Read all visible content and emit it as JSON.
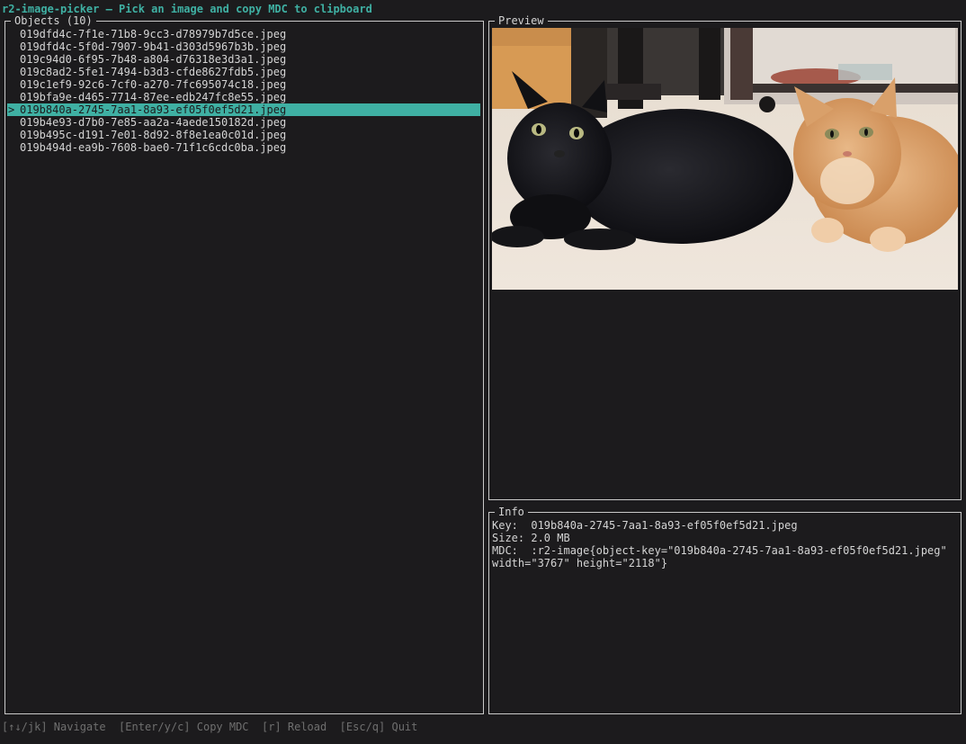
{
  "title": "r2-image-picker — Pick an image and copy MDC to clipboard",
  "objects": {
    "title": "Objects (10)",
    "selected_index": 6,
    "caret": ">",
    "items": [
      "019dfd4c-7f1e-71b8-9cc3-d78979b7d5ce.jpeg",
      "019dfd4c-5f0d-7907-9b41-d303d5967b3b.jpeg",
      "019c94d0-6f95-7b48-a804-d76318e3d3a1.jpeg",
      "019c8ad2-5fe1-7494-b3d3-cfde8627fdb5.jpeg",
      "019c1ef9-92c6-7cf0-a270-7fc695074c18.jpeg",
      "019bfa9e-d465-7714-87ee-edb247fc8e55.jpeg",
      "019b840a-2745-7aa1-8a93-ef05f0ef5d21.jpeg",
      "019b4e93-d7b0-7e85-aa2a-4aede150182d.jpeg",
      "019b495c-d191-7e01-8d92-8f8e1ea0c01d.jpeg",
      "019b494d-ea9b-7608-bae0-71f1c6cdc0ba.jpeg"
    ]
  },
  "preview": {
    "title": "Preview",
    "image_subject": "black-cat-and-orange-tabby-cat-photo"
  },
  "info": {
    "title": "Info",
    "key_line": "Key:  019b840a-2745-7aa1-8a93-ef05f0ef5d21.jpeg",
    "size_line": "Size: 2.0 MB",
    "mdc_line1": "MDC:  :r2-image{object-key=\"019b840a-2745-7aa1-8a93-ef05f0ef5d21.jpeg\"",
    "mdc_line2": "width=\"3767\" height=\"2118\"}"
  },
  "footer": "[↑↓/jk] Navigate  [Enter/y/c] Copy MDC  [r] Reload  [Esc/q] Quit",
  "colors": {
    "accent": "#3fb0a3",
    "background": "#1c1b1d",
    "border": "#c9c9c9",
    "text": "#d4d4d4",
    "muted": "#6f6f6f"
  }
}
